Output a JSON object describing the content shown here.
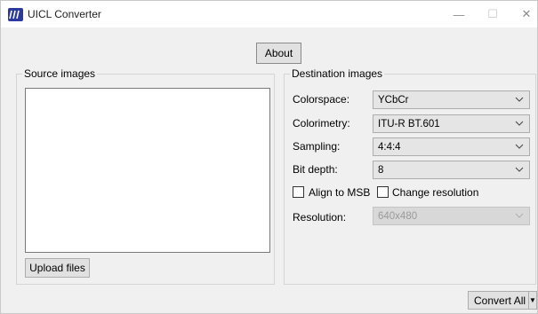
{
  "window": {
    "title": "UICL Converter",
    "minimize_glyph": "—",
    "maximize_glyph": "☐",
    "close_glyph": "✕"
  },
  "toolbar": {
    "about_label": "About"
  },
  "source": {
    "group_title": "Source images",
    "upload_label": "Upload files"
  },
  "destination": {
    "group_title": "Destination images",
    "fields": {
      "colorspace": {
        "label": "Colorspace:",
        "value": "YCbCr"
      },
      "colorimetry": {
        "label": "Colorimetry:",
        "value": "ITU-R BT.601"
      },
      "sampling": {
        "label": "Sampling:",
        "value": "4:4:4"
      },
      "bit_depth": {
        "label": "Bit depth:",
        "value": "8"
      },
      "resolution": {
        "label": "Resolution:",
        "value": "640x480",
        "disabled": true
      }
    },
    "align_to_msb": {
      "label": "Align to MSB",
      "checked": false
    },
    "change_resolution": {
      "label": "Change resolution",
      "checked": false
    }
  },
  "footer": {
    "convert_label": "Convert All",
    "convert_arrow": "▼"
  },
  "icons": {
    "app": "app-logo-icon",
    "dropdown": "chevron-down-icon"
  },
  "colors": {
    "app_icon": "#2b3a9c",
    "window_bg": "#f0f0f0"
  }
}
